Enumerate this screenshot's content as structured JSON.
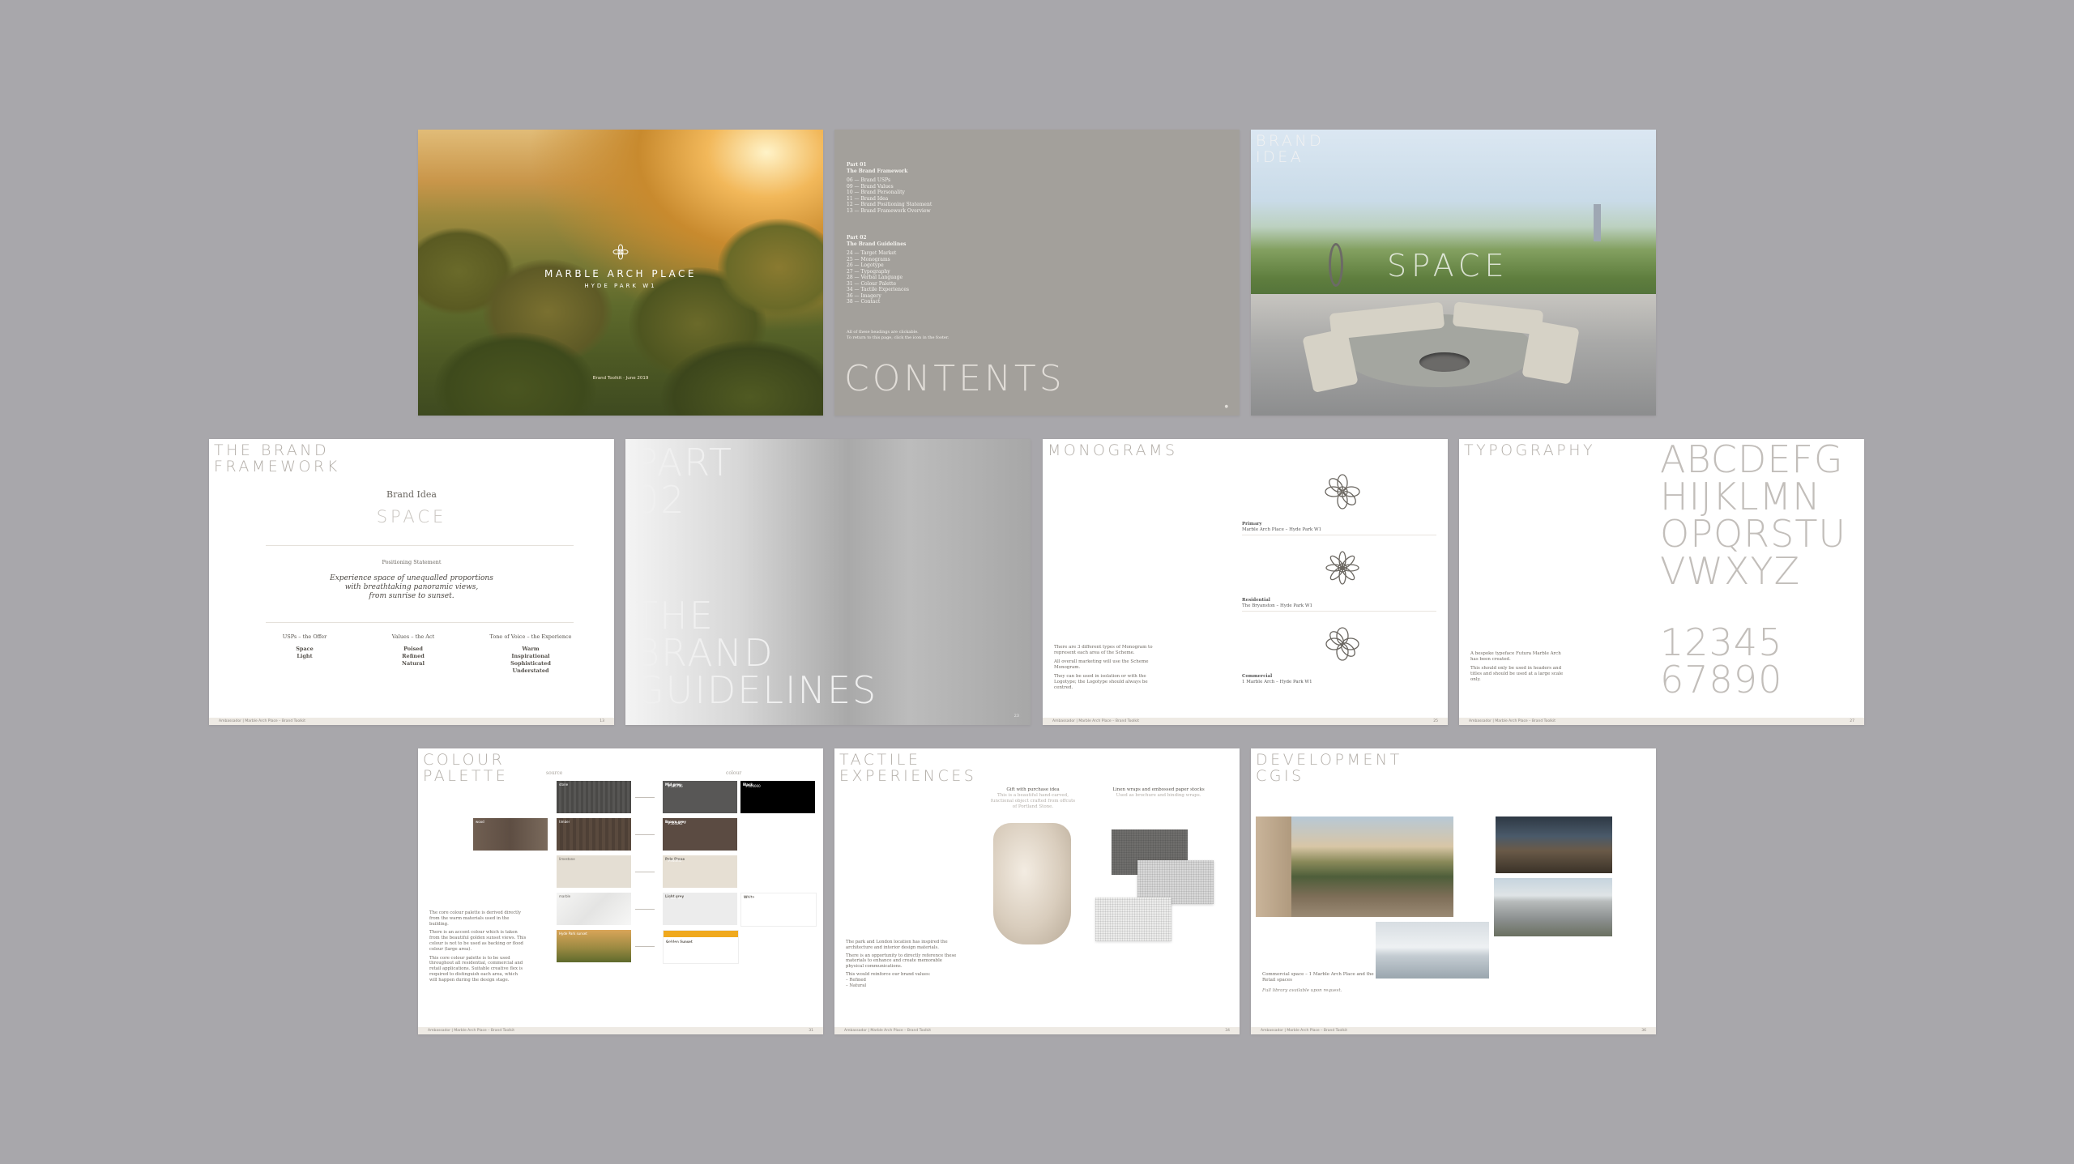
{
  "cover": {
    "title": "MARBLE ARCH PLACE",
    "subtitle": "HYDE PARK W1",
    "footer": "Brand Toolkit · June 2019"
  },
  "contents": {
    "part1_heading": "Part 01",
    "part1_title": "The Brand Framework",
    "part1_items": [
      "06    — Brand USPs",
      "09    — Brand Values",
      "10    — Brand Personality",
      "11    — Brand Idea",
      "12    — Brand Positioning Statement",
      "13    — Brand Framework Overview"
    ],
    "part2_heading": "Part 02",
    "part2_title": "The Brand Guidelines",
    "part2_items": [
      "24    — Target Market",
      "25    — Monograms",
      "26    — Logotype",
      "27    — Typography",
      "28    — Verbal Language",
      "31    — Colour Palette",
      "34    — Tactile Experiences",
      "36    — Imagery",
      "38    — Contact"
    ],
    "note_line1": "All of these headings are clickable.",
    "note_line2": "To return to this page, click the icon in the footer.",
    "title": "CONTENTS"
  },
  "brand_idea": {
    "headline": "BRAND\nIDEA",
    "word": "SPACE"
  },
  "framework": {
    "headline": "THE BRAND\nFRAMEWORK",
    "brand_idea_label": "Brand Idea",
    "brand_idea_value": "SPACE",
    "positioning_label": "Positioning Statement",
    "positioning_line1": "Experience space of unequalled proportions",
    "positioning_line2": "with breathtaking panoramic views,",
    "positioning_line3": "from sunrise to sunset.",
    "col1_title": "USPs – the Offer",
    "col1_items": [
      "Space",
      "Light"
    ],
    "col2_title": "Values – the Act",
    "col2_items": [
      "Poised",
      "Refined",
      "Natural"
    ],
    "col3_title": "Tone of Voice – the Experience",
    "col3_items": [
      "Warm",
      "Inspirational",
      "Sophisticated",
      "Understated"
    ],
    "footer": "Ambassador  |  Marble Arch Place – Brand Toolkit",
    "page": "13"
  },
  "part02": {
    "part": "PART\n02",
    "title": "THE\nBRAND\nGUIDELINES",
    "page": "23"
  },
  "monograms": {
    "headline": "MONOGRAMS",
    "label1_title": "Primary",
    "label1_text": "Marble Arch Place – Hyde Park W1",
    "label2_title": "Residential",
    "label2_text": "The Bryanston – Hyde Park W1",
    "label3_title": "Commercial",
    "label3_text": "1 Marble Arch – Hyde Park W1",
    "body1": "There are 3 different types of Monogram to represent each area of the Scheme.",
    "body2": "All overall marketing will use the Scheme Monogram.",
    "body3": "They can be used in isolation or with the Logotype; the Logotype should always be centred.",
    "footer": "Ambassador  |  Marble Arch Place – Brand Toolkit",
    "page": "25"
  },
  "typography": {
    "headline": "TYPOGRAPHY",
    "alphabet": "ABCDEFG\nHIJKLMN\nOPQRSTU\nVWXYZ",
    "numbers": "12345\n67890",
    "body1": "A bespoke typeface Futura Marble Arch has been created.",
    "body2": "This should only be used in headers and titles and should be used at a large scale only.",
    "footer": "Ambassador  |  Marble Arch Place – Brand Toolkit",
    "page": "27"
  },
  "palette": {
    "headline": "COLOUR\nPALETTE",
    "source_label": "source",
    "colour_label": "colour",
    "swatches": [
      {
        "name": "stone",
        "color": "#4d4c4a"
      },
      {
        "name": "wood",
        "color": "#6e5e52"
      },
      {
        "name": "timber",
        "color": "#5a4a3e"
      },
      {
        "name": "limestone",
        "color": "#e7e2d8"
      },
      {
        "name": "marble",
        "color": "#f0f0ef"
      },
      {
        "name": "Hyde Park sunset",
        "color": "#b98a3a"
      }
    ],
    "colours": [
      {
        "name": "Mid grey",
        "code": "#585756",
        "color": "#585756"
      },
      {
        "name": "Black",
        "code": "#000000",
        "color": "#000000"
      },
      {
        "name": "Brown grey",
        "code": "#5b4b42",
        "color": "#5b4b42"
      },
      {
        "name": "Pale Stone",
        "code": "#e6dfd3",
        "color": "#e6dfd3"
      },
      {
        "name": "Light grey",
        "code": "#ececec",
        "color": "#ececec"
      },
      {
        "name": "White",
        "code": "#ffffff",
        "color": "#ffffff"
      },
      {
        "name": "Golden Sunset",
        "code": "#f0a91e",
        "color": "#f0a91e"
      }
    ],
    "body1": "The core colour palette is derived directly from the warm materials used in the building.",
    "body2": "There is an accent colour which is taken from the beautiful golden sunset views. This colour is not to be used as backing or flood colour (large area).",
    "body3": "This core colour palette is to be used throughout all residential, commercial and retail applications. Suitable creative flex is required to distinguish each area, which will happen during the design stage.",
    "footer": "Ambassador  |  Marble Arch Place – Brand Toolkit",
    "page": "31"
  },
  "tactile": {
    "headline": "TACTILE\nEXPERIENCES",
    "gift_title": "Gift with purchase idea",
    "gift_text": "This is a beautiful hand-carved, functional object crafted from offcuts of Portland Stone.",
    "linen_title": "Linen wraps and embossed paper stocks",
    "linen_text": "Used as brochure and binding wraps.",
    "body1": "The park and London location has inspired the architecture and interior design materials.",
    "body2": "There is an opportunity to directly reference these materials to enhance and create memorable physical communications.",
    "body3": "This would reinforce our brand values:",
    "body4": "– Refined",
    "body5": "– Natural",
    "footer": "Ambassador  |  Marble Arch Place – Brand Toolkit",
    "page": "34"
  },
  "cgis": {
    "headline": "DEVELOPMENT\nCGIS",
    "body1": "Commercial space – 1 Marble Arch Place and the Retail spaces",
    "body2": "Full library available upon request.",
    "footer": "Ambassador  |  Marble Arch Place – Brand Toolkit",
    "page": "36"
  }
}
